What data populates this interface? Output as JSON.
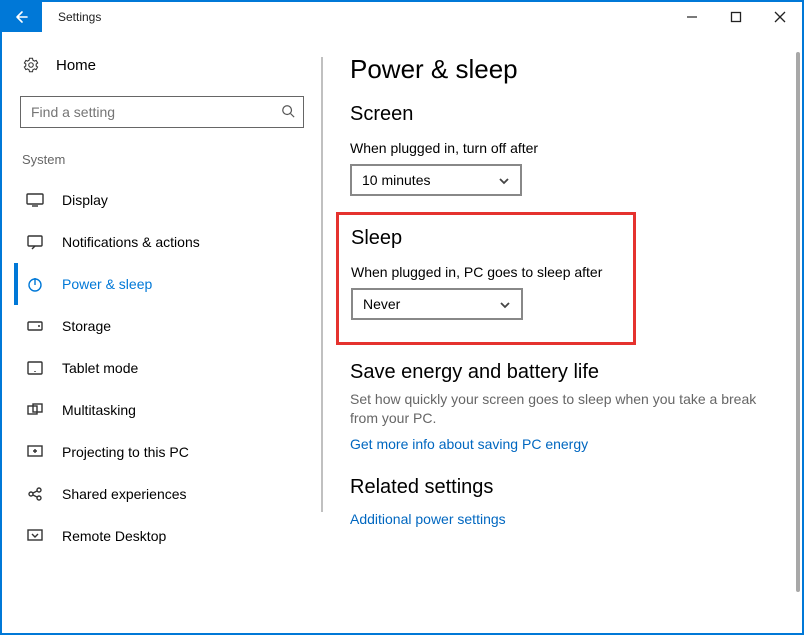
{
  "window": {
    "title": "Settings"
  },
  "sidebar": {
    "home_label": "Home",
    "search_placeholder": "Find a setting",
    "group_label": "System",
    "items": [
      {
        "label": "Display"
      },
      {
        "label": "Notifications & actions"
      },
      {
        "label": "Power & sleep"
      },
      {
        "label": "Storage"
      },
      {
        "label": "Tablet mode"
      },
      {
        "label": "Multitasking"
      },
      {
        "label": "Projecting to this PC"
      },
      {
        "label": "Shared experiences"
      },
      {
        "label": "Remote Desktop"
      }
    ]
  },
  "page": {
    "title": "Power & sleep",
    "screen": {
      "heading": "Screen",
      "label": "When plugged in, turn off after",
      "value": "10 minutes"
    },
    "sleep": {
      "heading": "Sleep",
      "label": "When plugged in, PC goes to sleep after",
      "value": "Never"
    },
    "energy": {
      "heading": "Save energy and battery life",
      "text": "Set how quickly your screen goes to sleep when you take a break from your PC.",
      "link": "Get more info about saving PC energy"
    },
    "related": {
      "heading": "Related settings",
      "link": "Additional power settings"
    }
  }
}
